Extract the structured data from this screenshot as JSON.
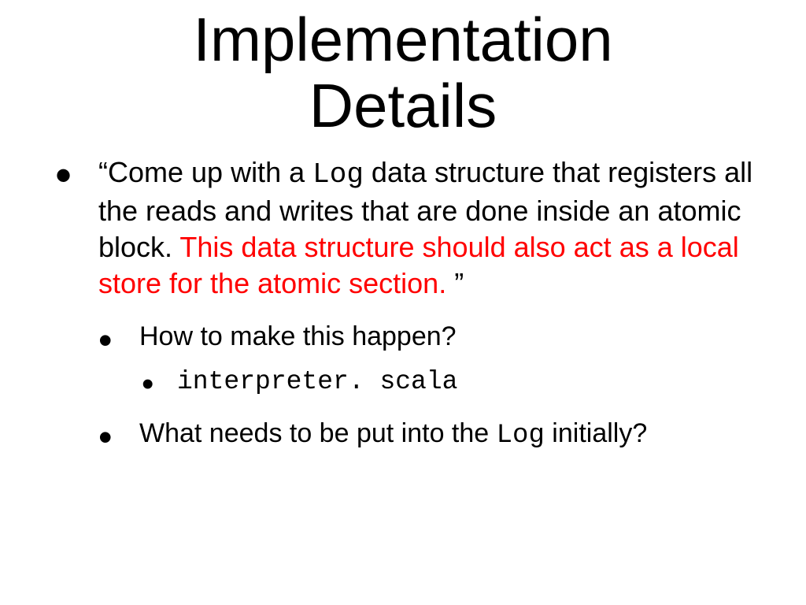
{
  "title": {
    "line1": "Implementation",
    "line2": "Details"
  },
  "bullet1": {
    "pre": "“Come up with a ",
    "code": "Log",
    "mid": " data structure that registers all the reads and writes that are done inside an atomic block. ",
    "red": "This data structure should also act as a local store for the atomic section.",
    "post": " ”"
  },
  "bullet2": "How to make this happen?",
  "bullet3": "interpreter. scala",
  "bullet4": {
    "pre": "What needs to be put into the ",
    "code": "Log",
    "post": " initially?"
  }
}
